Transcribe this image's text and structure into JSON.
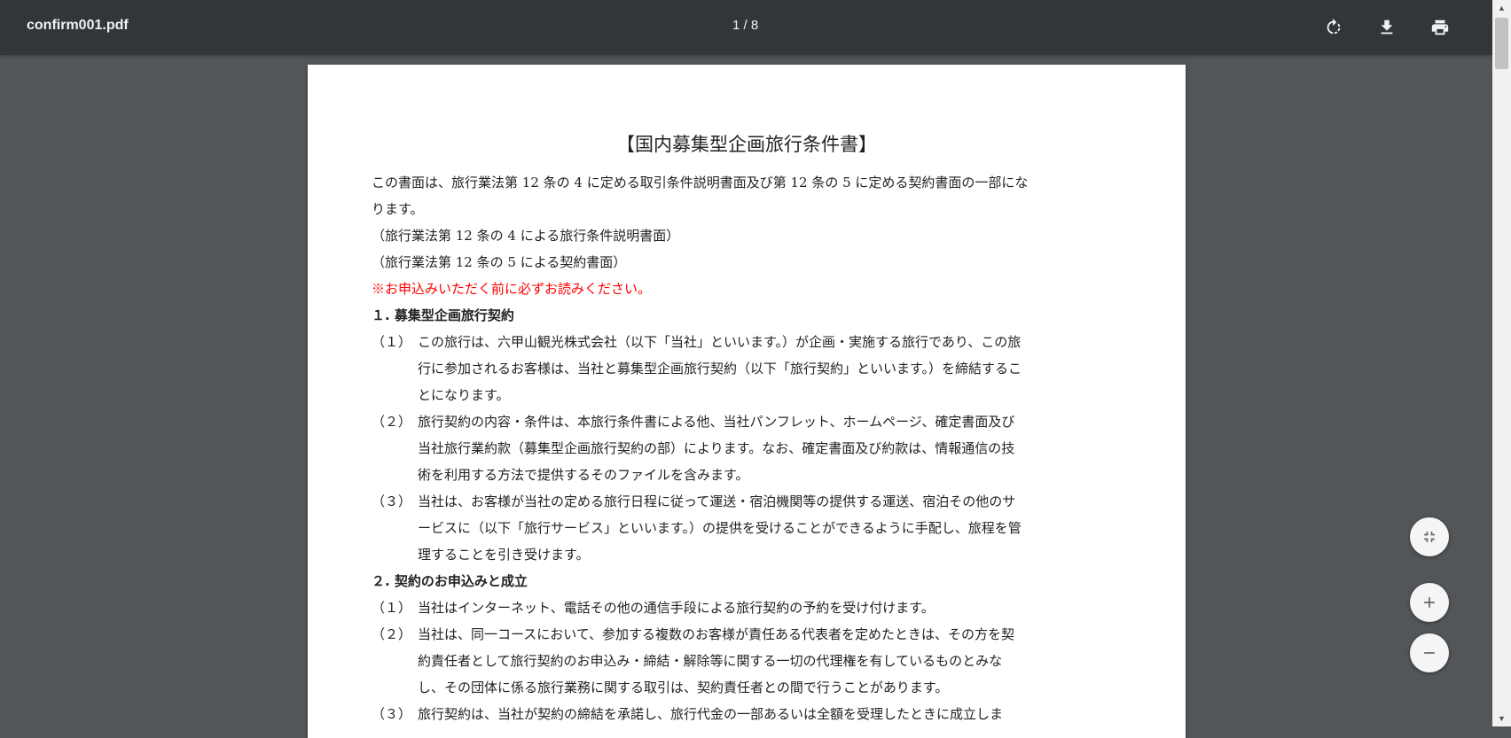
{
  "toolbar": {
    "file_name": "confirm001.pdf",
    "page_indicator": "1 / 8",
    "icons": [
      "rotate-icon",
      "download-icon",
      "print-icon"
    ]
  },
  "document": {
    "title": "【国内募集型企画旅行条件書】",
    "intro_lines": [
      "この書面は、旅行業法第 12 条の 4 に定める取引条件説明書面及び第 12 条の 5 に定める契約書面の一部にな",
      "ります。",
      "（旅行業法第 12 条の 4 による旅行条件説明書面）",
      "（旅行業法第 12 条の 5 による契約書面）"
    ],
    "notice": "※お申込みいただく前に必ずお読みください。",
    "section1": {
      "heading": "１. 募集型企画旅行契約",
      "items": [
        {
          "num": "（１）",
          "lines": [
            "この旅行は、六甲山観光株式会社（以下「当社」といいます。）が企画・実施する旅行であり、この旅",
            "行に参加されるお客様は、当社と募集型企画旅行契約（以下「旅行契約」といいます。）を締結するこ",
            "とになります。"
          ]
        },
        {
          "num": "（２）",
          "lines": [
            "旅行契約の内容・条件は、本旅行条件書による他、当社パンフレット、ホームページ、確定書面及び",
            "当社旅行業約款（募集型企画旅行契約の部）によります。なお、確定書面及び約款は、情報通信の技",
            "術を利用する方法で提供するそのファイルを含みます。"
          ]
        },
        {
          "num": "（３）",
          "lines": [
            "当社は、お客様が当社の定める旅行日程に従って運送・宿泊機関等の提供する運送、宿泊その他のサ",
            "ービスに（以下「旅行サービス」といいます。）の提供を受けることができるように手配し、旅程を管",
            "理することを引き受けます。"
          ]
        }
      ]
    },
    "section2": {
      "heading": "２. 契約のお申込みと成立",
      "items": [
        {
          "num": "（１）",
          "lines": [
            "当社はインターネット、電話その他の通信手段による旅行契約の予約を受け付けます。"
          ]
        },
        {
          "num": "（２）",
          "lines": [
            "当社は、同一コースにおいて、参加する複数のお客様が責任ある代表者を定めたときは、その方を契",
            "約責任者として旅行契約のお申込み・締結・解除等に関する一切の代理権を有しているものとみな",
            "し、その団体に係る旅行業務に関する取引は、契約責任者との間で行うことがあります。"
          ]
        },
        {
          "num": "（３）",
          "lines": [
            "旅行契約は、当社が契約の締結を承諾し、旅行代金の一部あるいは全額を受理したときに成立しま"
          ]
        }
      ]
    }
  },
  "controls": {
    "fit": "fit-to-page-icon",
    "zoom_in": "zoom-in-icon",
    "zoom_out": "zoom-out-icon"
  }
}
